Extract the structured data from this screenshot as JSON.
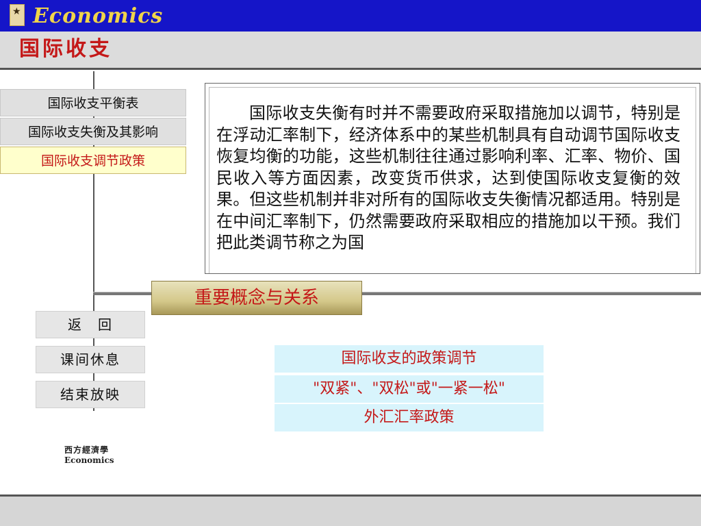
{
  "header": {
    "logo_glyph": "★",
    "app_title": "Economics",
    "section_title": "国际收支",
    "banner_color": "#1515c8",
    "accent_color": "#c41818"
  },
  "nav": {
    "items": [
      {
        "label": "国际收支平衡表"
      },
      {
        "label": "国际收支失衡及其影响"
      },
      {
        "label": "国际收支调节政策"
      }
    ]
  },
  "content": {
    "body_text": "国际收支失衡有时并不需要政府采取措施加以调节，特别是在浮动汇率制下，经济体系中的某些机制具有自动调节国际收支恢复均衡的功能，这些机制往往通过影响利率、汇率、物价、国民收入等方面因素，改变货币供求，达到使国际收支复衡的效果。但这些机制并非对所有的国际收支失衡情况都适用。特别是在中间汇率制下，仍然需要政府采取相应的措施加以干预。我们把此类调节称之为国"
  },
  "concepts": {
    "banner_label": "重要概念与关系",
    "items": [
      {
        "label": "国际收支的政策调节"
      },
      {
        "label": "\"双紧\"、\"双松\"或\"一紧一松\""
      },
      {
        "label": "外汇汇率政策"
      }
    ]
  },
  "buttons": {
    "back": "返　回",
    "break": "课间休息",
    "end": "结束放映"
  },
  "footer": {
    "logo_cn": "西方經濟學",
    "logo_en": "Economics"
  }
}
